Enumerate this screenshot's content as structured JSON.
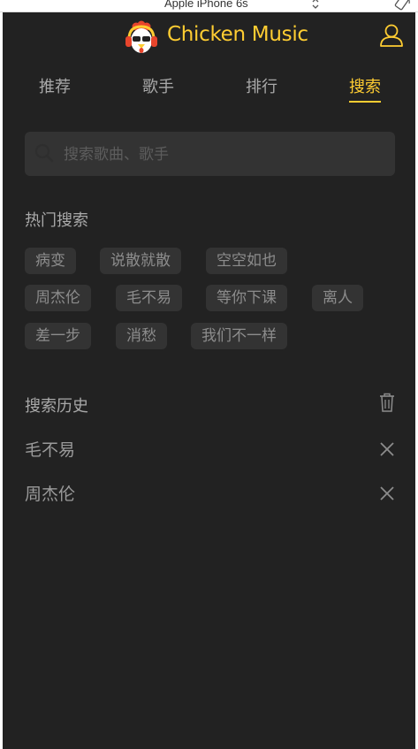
{
  "device": {
    "name": "Apple iPhone 6s"
  },
  "app": {
    "title": "Chicken Music"
  },
  "colors": {
    "accent": "#ffcd32",
    "background": "#222222",
    "surface": "#333333"
  },
  "tabs": [
    {
      "label": "推荐"
    },
    {
      "label": "歌手"
    },
    {
      "label": "排行"
    },
    {
      "label": "搜索",
      "active": true
    }
  ],
  "search": {
    "placeholder": "搜索歌曲、歌手",
    "value": ""
  },
  "hot": {
    "title": "热门搜索",
    "keys": [
      "病变",
      "说散就散",
      "空空如也",
      "周杰伦",
      "毛不易",
      "等你下课",
      "离人",
      "差一步",
      "消愁",
      "我们不一样"
    ]
  },
  "history": {
    "title": "搜索历史",
    "items": [
      "毛不易",
      "周杰伦"
    ]
  },
  "icons": {
    "logo": "chicken-logo-icon",
    "user": "user-icon",
    "search": "search-icon",
    "trash": "trash-icon",
    "close": "close-icon"
  }
}
